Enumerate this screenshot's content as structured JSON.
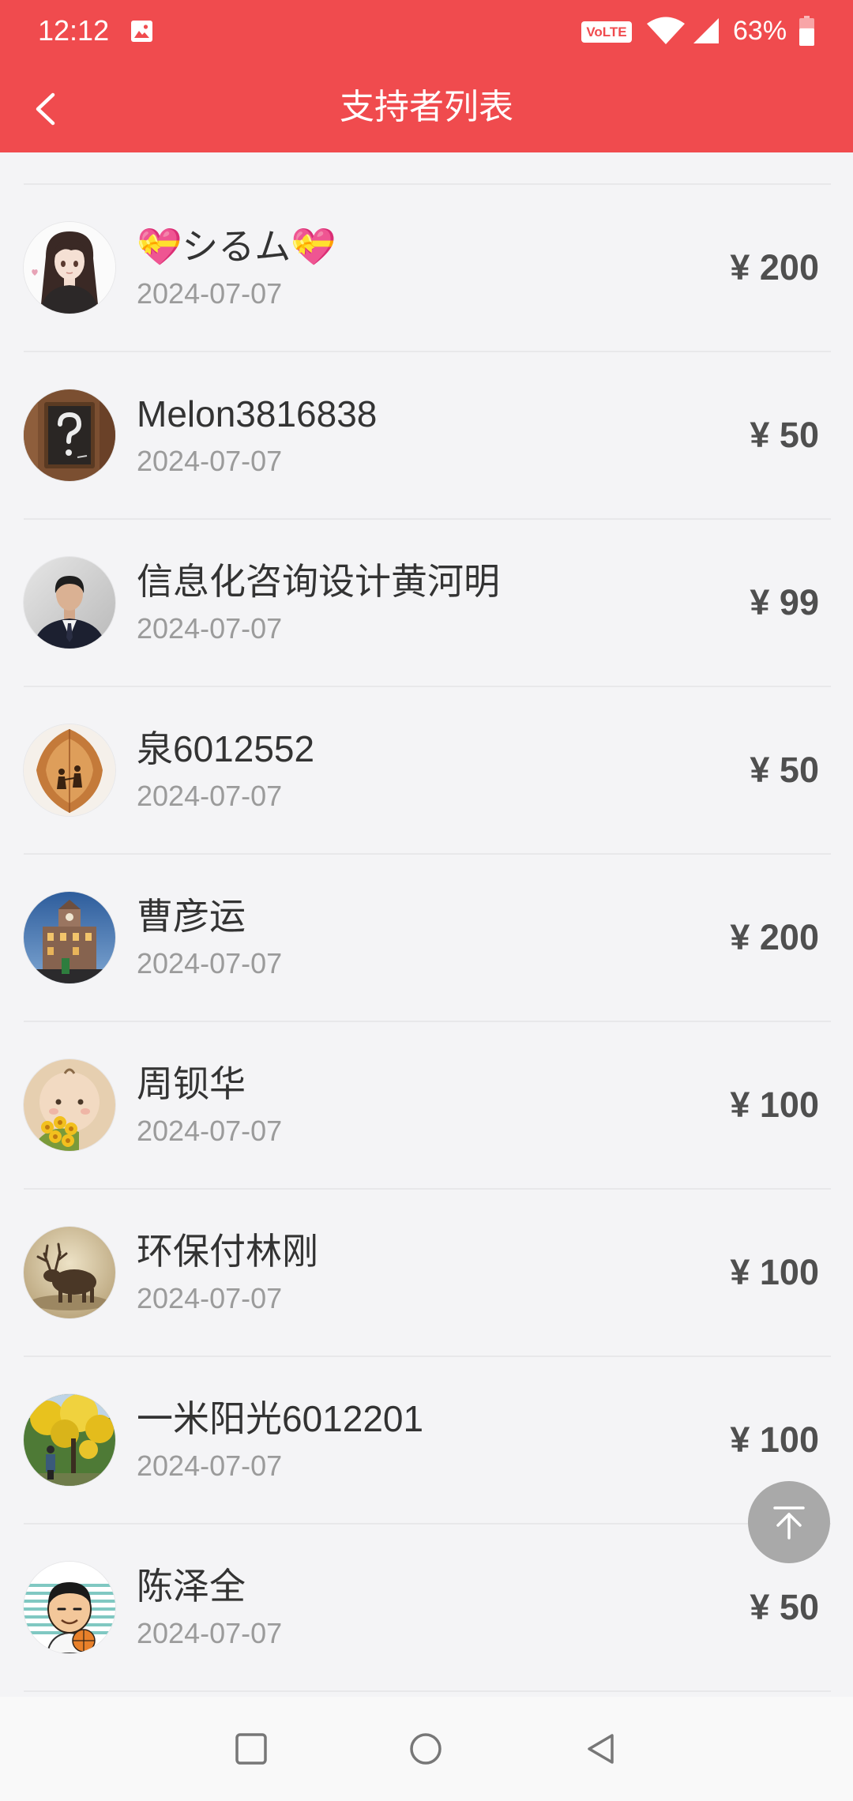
{
  "status_bar": {
    "time": "12:12",
    "network_badge": "VoLTE",
    "battery_percent": "63%",
    "battery_level": 0.63,
    "icons": {
      "notification": "image-icon",
      "wifi": "wifi-icon",
      "signal": "cellular-signal-icon",
      "battery": "battery-icon"
    }
  },
  "header": {
    "title": "支持者列表",
    "back_icon": "chevron-left-icon"
  },
  "supporters": [
    {
      "name": "💝シるム💝",
      "date": "2024-07-07",
      "amount": "¥ 200"
    },
    {
      "name": "Melon3816838",
      "date": "2024-07-07",
      "amount": "¥ 50"
    },
    {
      "name": "信息化咨询设计黄河明",
      "date": "2024-07-07",
      "amount": "¥ 99"
    },
    {
      "name": "泉6012552",
      "date": "2024-07-07",
      "amount": "¥ 50"
    },
    {
      "name": "曹彦运",
      "date": "2024-07-07",
      "amount": "¥ 200"
    },
    {
      "name": "周钡华",
      "date": "2024-07-07",
      "amount": "¥ 100"
    },
    {
      "name": "环保付林刚",
      "date": "2024-07-07",
      "amount": "¥ 100"
    },
    {
      "name": "一米阳光6012201",
      "date": "2024-07-07",
      "amount": "¥ 100"
    },
    {
      "name": "陈泽全",
      "date": "2024-07-07",
      "amount": "¥ 50"
    }
  ],
  "scroll_to_top": {
    "icon": "arrow-up-to-top-icon"
  },
  "nav_bar": {
    "icons": [
      "recents-square-icon",
      "home-circle-icon",
      "back-triangle-icon"
    ]
  },
  "colors": {
    "header_background": "#F04B4E",
    "page_background": "#F4F4F6",
    "name_text": "#333333",
    "date_text": "#9B9B9B",
    "amount_text": "#4F4F4F",
    "scroll_button": "#A9A9A9"
  }
}
